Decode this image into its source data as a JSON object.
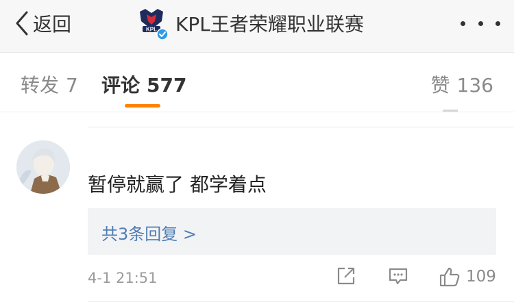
{
  "header": {
    "back_label": "返回",
    "title": "KPL王者荣耀职业联赛",
    "logo_text": "KPL"
  },
  "tabs": [
    {
      "label": "转发",
      "count": "7",
      "active": false
    },
    {
      "label": "评论",
      "count": "577",
      "active": true
    },
    {
      "label": "赞",
      "count": "136",
      "active": false
    }
  ],
  "accent_color": "#ff8200",
  "link_color": "#4f7db3",
  "comment": {
    "text": "暂停就赢了 都学着点",
    "replies_label": "共3条回复 >",
    "timestamp": "4-1 21:51",
    "like_count": "109"
  }
}
